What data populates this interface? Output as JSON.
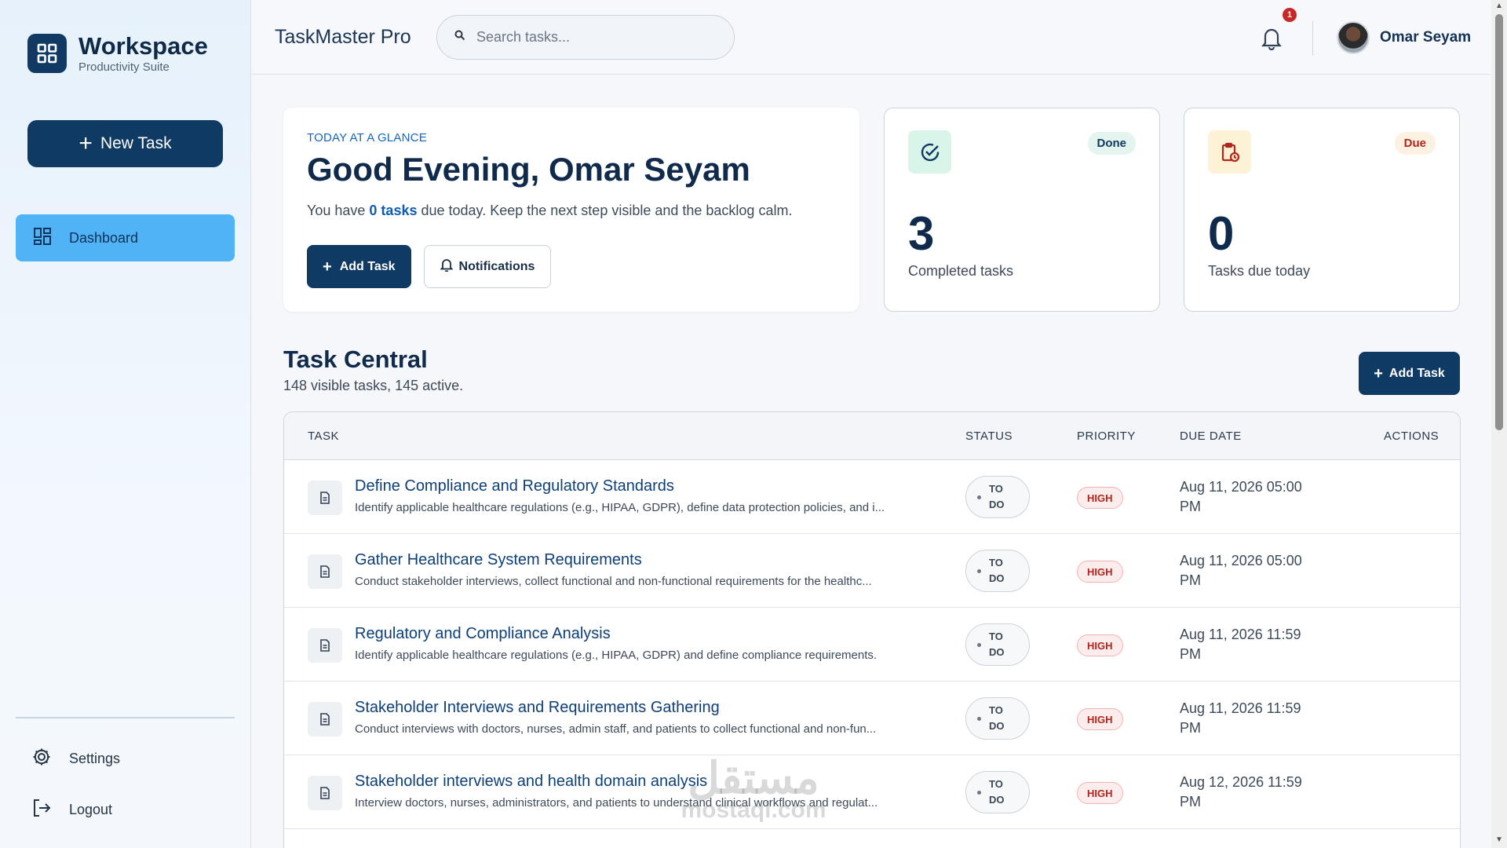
{
  "sidebar": {
    "brand_name": "Workspace",
    "brand_sub": "Productivity Suite",
    "new_task": "New Task",
    "nav": [
      {
        "label": "Dashboard",
        "icon": "dashboard-icon",
        "active": true
      }
    ],
    "settings": "Settings",
    "logout": "Logout"
  },
  "header": {
    "app_title": "TaskMaster Pro",
    "search_placeholder": "Search tasks...",
    "notification_count": "1",
    "user_name": "Omar Seyam"
  },
  "welcome": {
    "eyebrow": "TODAY AT A GLANCE",
    "greeting": "Good Evening, Omar Seyam",
    "sub_before": "You have ",
    "sub_highlight": "0 tasks",
    "sub_after": " due today. Keep the next step visible and the backlog calm.",
    "add_task": "Add Task",
    "notifications": "Notifications"
  },
  "stats": {
    "completed": {
      "pill": "Done",
      "value": "3",
      "caption": "Completed tasks"
    },
    "due": {
      "pill": "Due",
      "value": "0",
      "caption": "Tasks due today"
    }
  },
  "task_central": {
    "title": "Task Central",
    "subtitle": "148 visible tasks, 145 active.",
    "add_task": "Add Task",
    "columns": [
      "TASK",
      "STATUS",
      "PRIORITY",
      "DUE DATE",
      "ACTIONS"
    ],
    "rows": [
      {
        "title": "Define Compliance and Regulatory Standards",
        "desc": "Identify applicable healthcare regulations (e.g., HIPAA, GDPR), define data protection policies, and i...",
        "status": "TO DO",
        "priority": "HIGH",
        "due": "Aug 11, 2026 05:00 PM"
      },
      {
        "title": "Gather Healthcare System Requirements",
        "desc": "Conduct stakeholder interviews, collect functional and non-functional requirements for the healthc...",
        "status": "TO DO",
        "priority": "HIGH",
        "due": "Aug 11, 2026 05:00 PM"
      },
      {
        "title": "Regulatory and Compliance Analysis",
        "desc": "Identify applicable healthcare regulations (e.g., HIPAA, GDPR) and define compliance requirements.",
        "status": "TO DO",
        "priority": "HIGH",
        "due": "Aug 11, 2026 11:59 PM"
      },
      {
        "title": "Stakeholder Interviews and Requirements Gathering",
        "desc": "Conduct interviews with doctors, nurses, admin staff, and patients to collect functional and non-fun...",
        "status": "TO DO",
        "priority": "HIGH",
        "due": "Aug 11, 2026 11:59 PM"
      },
      {
        "title": "Stakeholder interviews and health domain analysis",
        "desc": "Interview doctors, nurses, administrators, and patients to understand clinical workflows and regulat...",
        "status": "TO DO",
        "priority": "HIGH",
        "due": "Aug 12, 2026 11:59 PM"
      }
    ]
  },
  "watermark": {
    "line1": "مستقل",
    "line2": "mostaql.com"
  },
  "colors": {
    "primary": "#0f3a63",
    "accent": "#4fb3f6",
    "danger": "#b3261e",
    "done_bg": "#d9f5ea",
    "due_bg": "#fdf1d6"
  }
}
